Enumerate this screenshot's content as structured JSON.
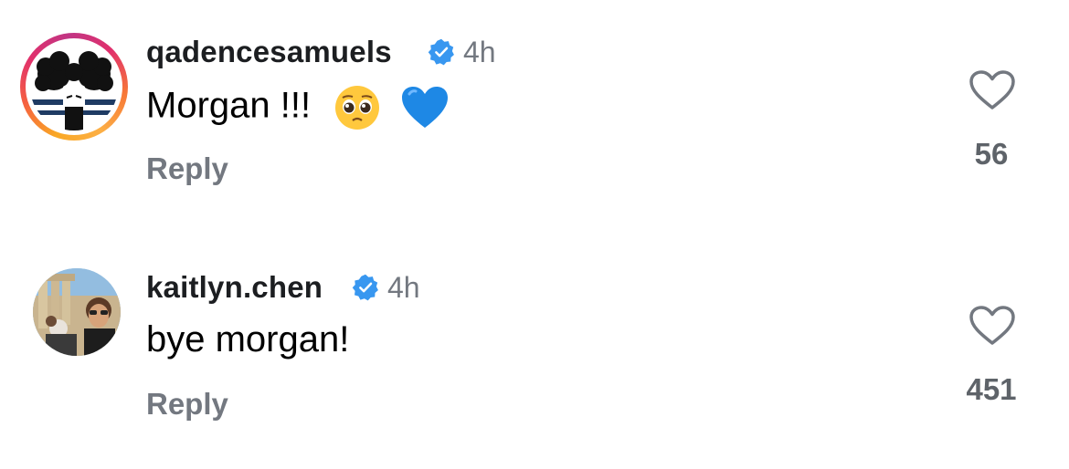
{
  "comments": [
    {
      "username": "qadencesamuels",
      "verified": true,
      "time": "4h",
      "text": "Morgan !!!",
      "emojis": [
        "pleading-face-emoji",
        "blue-heart-emoji"
      ],
      "reply_label": "Reply",
      "likes": "56",
      "avatar": "afro-silhouette-avatar",
      "story_ring": true
    },
    {
      "username": "kaitlyn.chen",
      "verified": true,
      "time": "4h",
      "text": "bye morgan!",
      "emojis": [],
      "reply_label": "Reply",
      "likes": "451",
      "avatar": "photo-avatar",
      "story_ring": false
    }
  ],
  "colors": {
    "verified": "#3897f0",
    "secondary_text": "#737880",
    "primary_text": "#1c1e21"
  }
}
